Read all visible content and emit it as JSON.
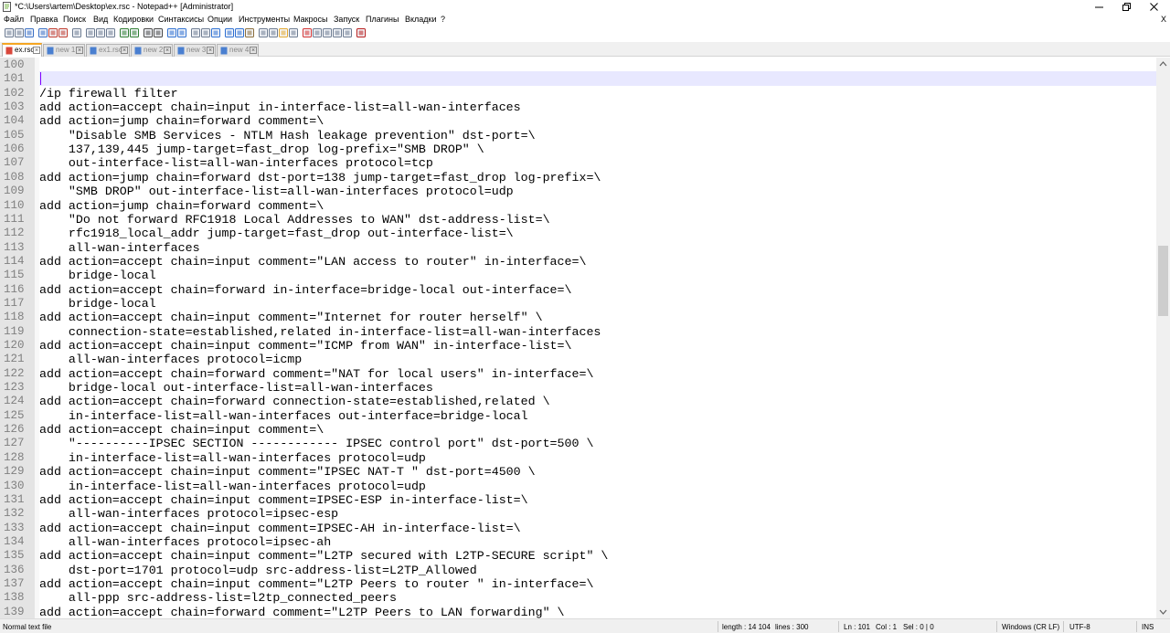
{
  "window": {
    "title": "*C:\\Users\\artem\\Desktop\\ex.rsc - Notepad++ [Administrator]"
  },
  "menu": {
    "items": [
      "Файл",
      "Правка",
      "Поиск",
      "Вид",
      "Кодировки",
      "Синтаксисы",
      "Опции",
      "Инструменты",
      "Макросы",
      "Запуск",
      "Плагины",
      "Вкладки",
      "?"
    ],
    "close_glyph": "X"
  },
  "toolbar": {
    "icons": [
      "new-file-icon",
      "open-file-icon",
      "save-icon",
      "save-all-icon",
      "close-icon",
      "close-all-icon",
      "print-icon",
      "cut-icon",
      "copy-icon",
      "paste-icon",
      "undo-icon",
      "redo-icon",
      "find-icon",
      "replace-icon",
      "zoom-in-icon",
      "zoom-out-icon",
      "sync-vertical-icon",
      "sync-horizontal-icon",
      "word-wrap-icon",
      "show-all-chars-icon",
      "indent-guide-icon",
      "language-icon",
      "doc-map-icon",
      "function-list-icon",
      "folder-workspace-icon",
      "monitoring-icon",
      "record-macro-icon",
      "stop-macro-icon",
      "play-macro-icon",
      "run-macro-multiple-icon",
      "save-macro-icon",
      "spell-check-icon"
    ]
  },
  "tabs": [
    {
      "label": "ex.rsc",
      "active": true,
      "saved": false
    },
    {
      "label": "new 1",
      "active": false,
      "saved": true
    },
    {
      "label": "ex1.rsc",
      "active": false,
      "saved": true
    },
    {
      "label": "new 2",
      "active": false,
      "saved": true
    },
    {
      "label": "new 3",
      "active": false,
      "saved": true
    },
    {
      "label": "new 4",
      "active": false,
      "saved": true
    }
  ],
  "editor": {
    "current_line": 101,
    "lines": [
      {
        "n": "100",
        "text": ""
      },
      {
        "n": "101",
        "text": ""
      },
      {
        "n": "102",
        "text": "/ip firewall filter"
      },
      {
        "n": "103",
        "text": "add action=accept chain=input in-interface-list=all-wan-interfaces"
      },
      {
        "n": "104",
        "text": "add action=jump chain=forward comment=\\"
      },
      {
        "n": "105",
        "text": "    \"Disable SMB Services - NTLM Hash leakage prevention\" dst-port=\\"
      },
      {
        "n": "106",
        "text": "    137,139,445 jump-target=fast_drop log-prefix=\"SMB DROP\" \\"
      },
      {
        "n": "107",
        "text": "    out-interface-list=all-wan-interfaces protocol=tcp"
      },
      {
        "n": "108",
        "text": "add action=jump chain=forward dst-port=138 jump-target=fast_drop log-prefix=\\"
      },
      {
        "n": "109",
        "text": "    \"SMB DROP\" out-interface-list=all-wan-interfaces protocol=udp"
      },
      {
        "n": "110",
        "text": "add action=jump chain=forward comment=\\"
      },
      {
        "n": "111",
        "text": "    \"Do not forward RFC1918 Local Addresses to WAN\" dst-address-list=\\"
      },
      {
        "n": "112",
        "text": "    rfc1918_local_addr jump-target=fast_drop out-interface-list=\\"
      },
      {
        "n": "113",
        "text": "    all-wan-interfaces"
      },
      {
        "n": "114",
        "text": "add action=accept chain=input comment=\"LAN access to router\" in-interface=\\"
      },
      {
        "n": "115",
        "text": "    bridge-local"
      },
      {
        "n": "116",
        "text": "add action=accept chain=forward in-interface=bridge-local out-interface=\\"
      },
      {
        "n": "117",
        "text": "    bridge-local"
      },
      {
        "n": "118",
        "text": "add action=accept chain=input comment=\"Internet for router herself\" \\"
      },
      {
        "n": "119",
        "text": "    connection-state=established,related in-interface-list=all-wan-interfaces"
      },
      {
        "n": "120",
        "text": "add action=accept chain=input comment=\"ICMP from WAN\" in-interface-list=\\"
      },
      {
        "n": "121",
        "text": "    all-wan-interfaces protocol=icmp"
      },
      {
        "n": "122",
        "text": "add action=accept chain=forward comment=\"NAT for local users\" in-interface=\\"
      },
      {
        "n": "123",
        "text": "    bridge-local out-interface-list=all-wan-interfaces"
      },
      {
        "n": "124",
        "text": "add action=accept chain=forward connection-state=established,related \\"
      },
      {
        "n": "125",
        "text": "    in-interface-list=all-wan-interfaces out-interface=bridge-local"
      },
      {
        "n": "126",
        "text": "add action=accept chain=input comment=\\"
      },
      {
        "n": "127",
        "text": "    \"----------IPSEC SECTION ------------ IPSEC control port\" dst-port=500 \\"
      },
      {
        "n": "128",
        "text": "    in-interface-list=all-wan-interfaces protocol=udp"
      },
      {
        "n": "129",
        "text": "add action=accept chain=input comment=\"IPSEC NAT-T \" dst-port=4500 \\"
      },
      {
        "n": "130",
        "text": "    in-interface-list=all-wan-interfaces protocol=udp"
      },
      {
        "n": "131",
        "text": "add action=accept chain=input comment=IPSEC-ESP in-interface-list=\\"
      },
      {
        "n": "132",
        "text": "    all-wan-interfaces protocol=ipsec-esp"
      },
      {
        "n": "133",
        "text": "add action=accept chain=input comment=IPSEC-AH in-interface-list=\\"
      },
      {
        "n": "134",
        "text": "    all-wan-interfaces protocol=ipsec-ah"
      },
      {
        "n": "135",
        "text": "add action=accept chain=input comment=\"L2TP secured with L2TP-SECURE script\" \\"
      },
      {
        "n": "136",
        "text": "    dst-port=1701 protocol=udp src-address-list=L2TP_Allowed"
      },
      {
        "n": "137",
        "text": "add action=accept chain=input comment=\"L2TP Peers to router \" in-interface=\\"
      },
      {
        "n": "138",
        "text": "    all-ppp src-address-list=l2tp_connected_peers"
      },
      {
        "n": "139",
        "text": "add action=accept chain=forward comment=\"L2TP Peers to LAN forwarding\" \\"
      }
    ]
  },
  "statusbar": {
    "file_type": "Normal text file",
    "length": "length : 14 104",
    "lines": "lines : 300",
    "ln": "Ln : 101",
    "col": "Col : 1",
    "sel": "Sel : 0 | 0",
    "eol": "Windows (CR LF)",
    "encoding": "UTF-8",
    "mode": "INS"
  }
}
